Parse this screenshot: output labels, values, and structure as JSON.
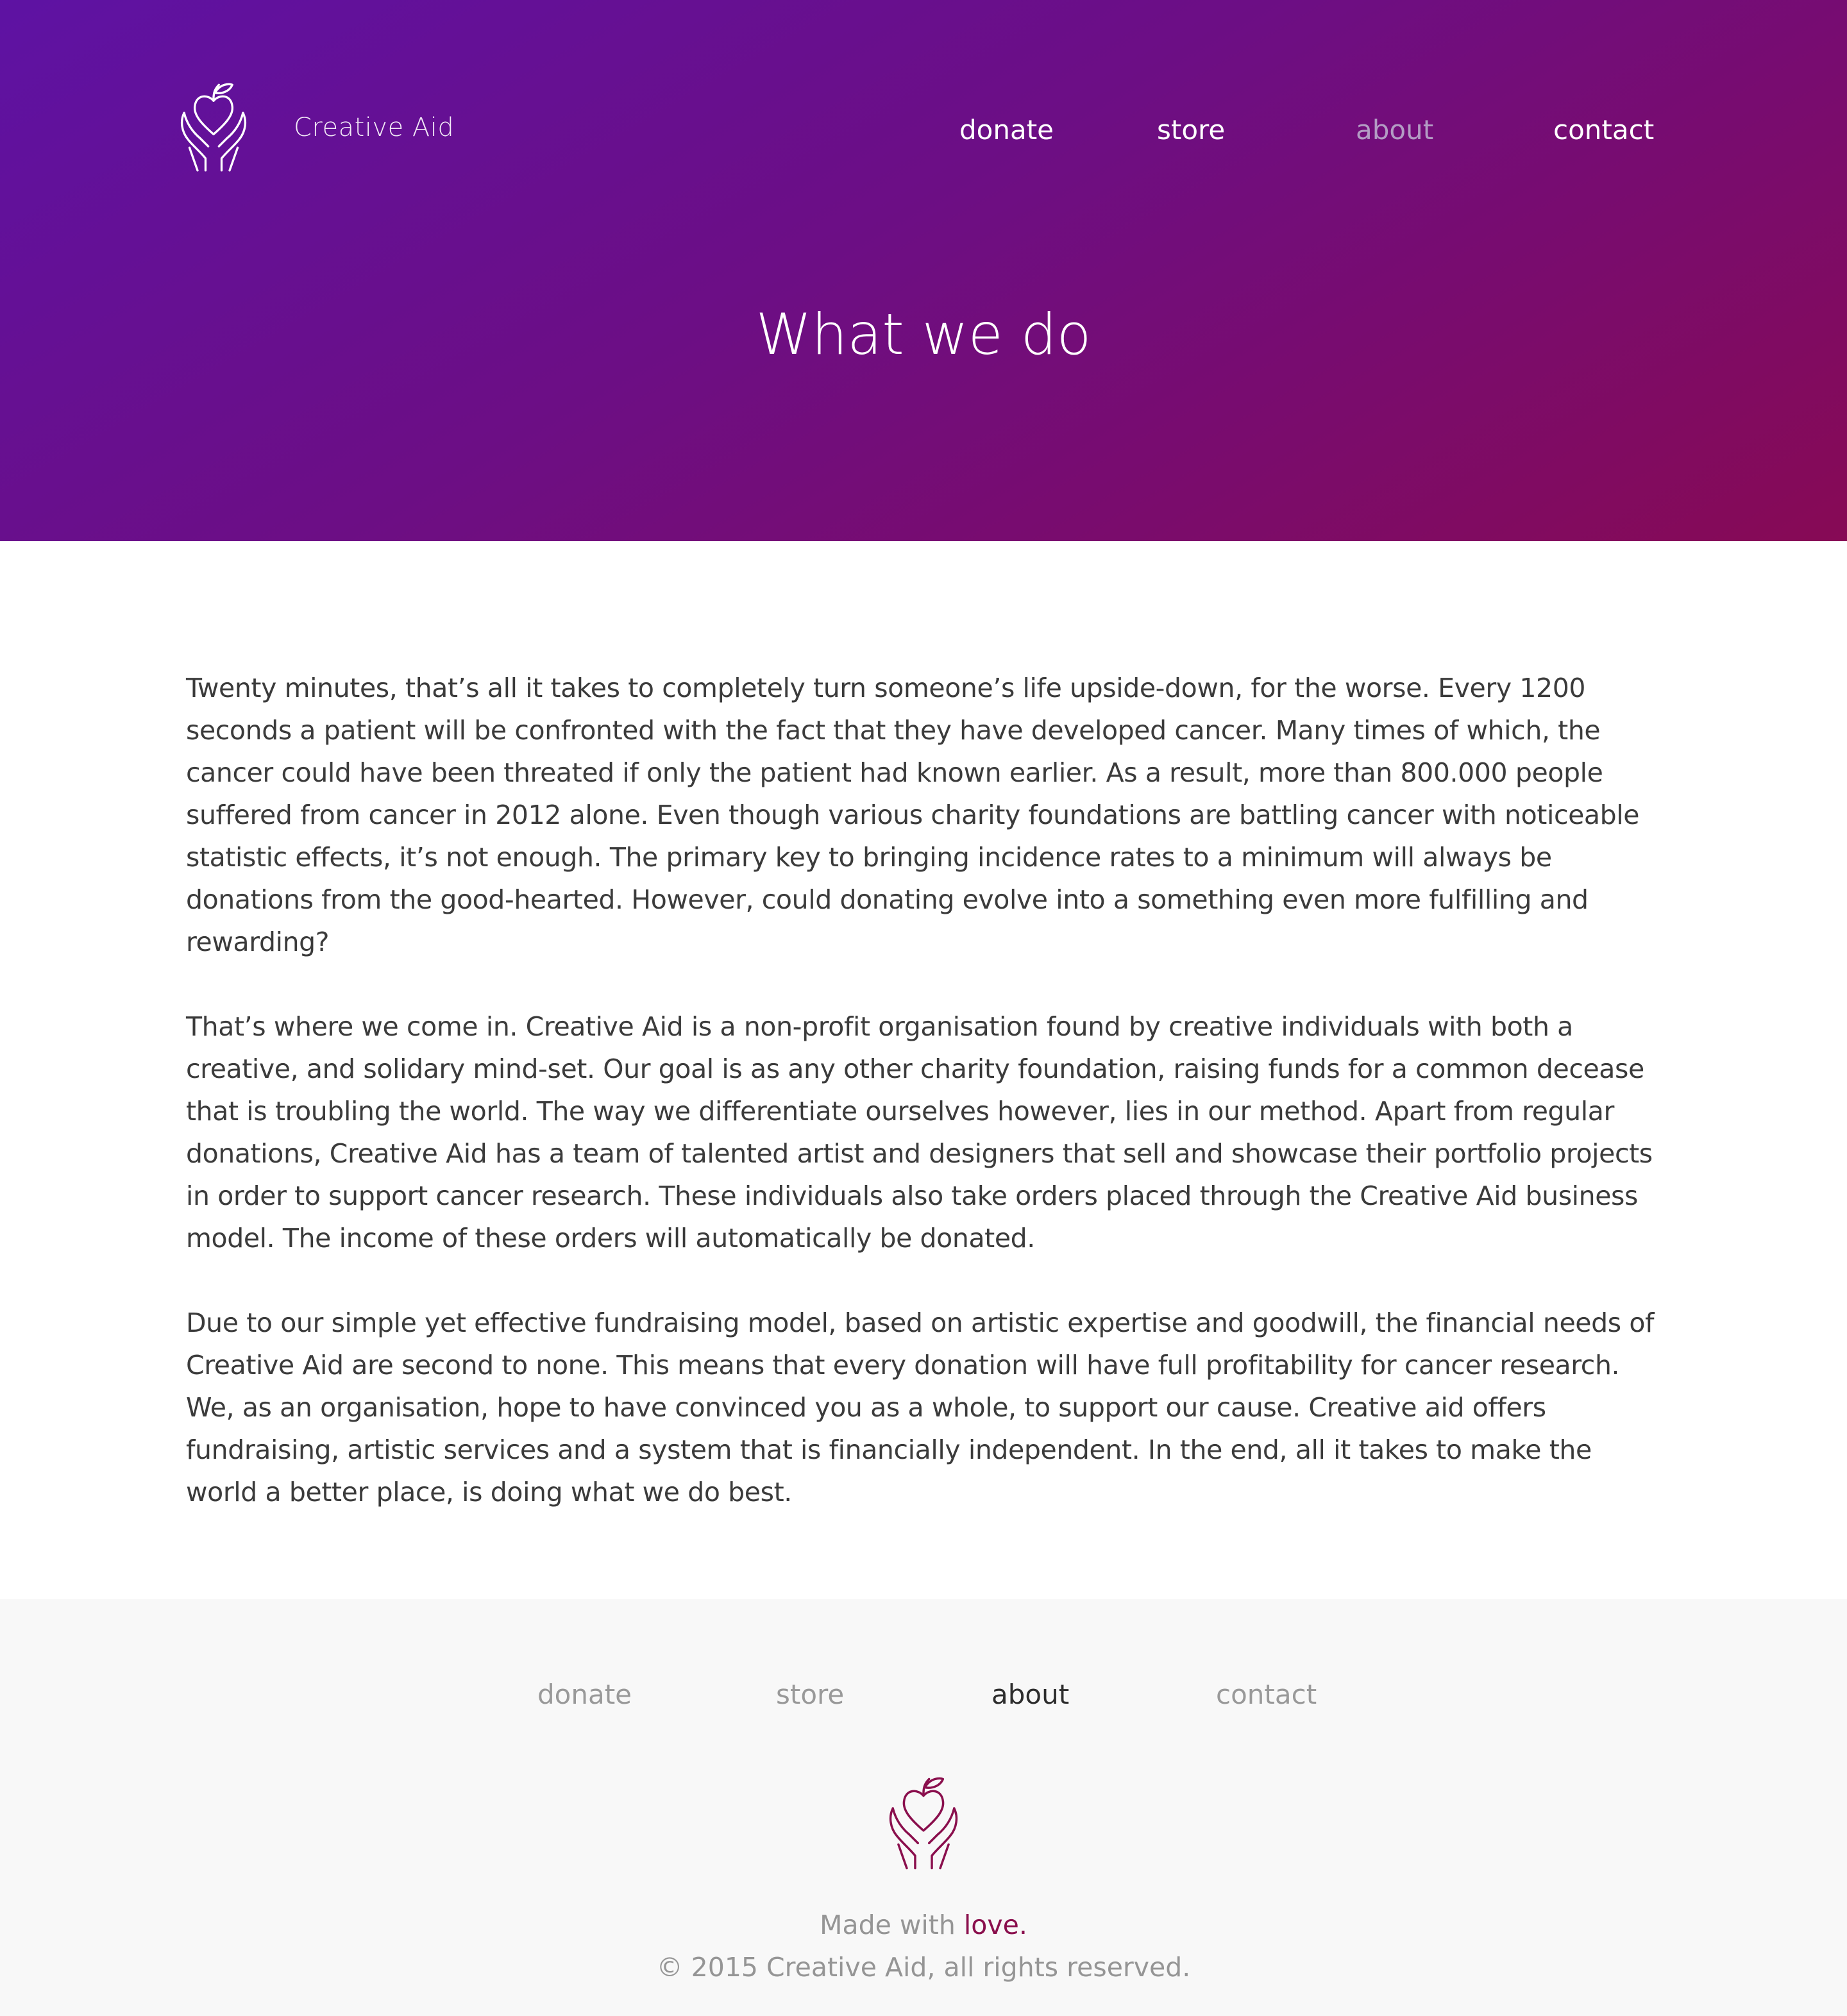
{
  "header": {
    "brand": "Creative Aid",
    "logo_icon": "heart-apple-hands-icon",
    "nav": [
      {
        "label": "donate",
        "active": false
      },
      {
        "label": "store",
        "active": false
      },
      {
        "label": "about",
        "active": true
      },
      {
        "label": "contact",
        "active": false
      }
    ]
  },
  "hero": {
    "title": "What we do",
    "gradient_start": "#5e12a3",
    "gradient_end": "#870a55"
  },
  "main": {
    "paragraphs": [
      "Twenty minutes, that’s all it takes to completely turn someone’s life upside-down, for the worse. Every 1200 seconds a patient will be confronted with the fact that they have developed cancer. Many times of which, the cancer could have been threated if only the patient had known earlier. As a result, more than 800.000 people suffered from cancer in 2012 alone. Even though various charity foundations are battling cancer with noticeable statistic effects, it’s not enough. The primary key to bringing incidence rates to a minimum will always be donations from the good-hearted. However, could donating evolve into a something even more fulfilling and rewarding?",
      "That’s where we come in. Creative Aid is a non-profit organisation found by creative individuals with both a creative, and solidary mind-set. Our goal is as any other charity foundation, raising funds for a common decease that is troubling the world. The way we differentiate ourselves however, lies in our method. Apart from regular donations, Creative Aid has a team of talented artist and designers that sell and showcase their portfolio projects in order to support cancer research. These individuals also take orders placed through the Creative Aid business model. The income of these orders will automatically be donated.",
      "Due to our simple yet effective fundraising model, based on artistic expertise and goodwill, the financial needs of Creative Aid are second to none. This means that every donation will have full profitability for cancer research. We, as an organisation, hope to have convinced you as a whole, to support our cause. Creative aid offers fundraising, artistic services and a system that is financially independent. In the end, all it takes to make the world a better place, is doing what we do best."
    ]
  },
  "footer": {
    "nav": [
      {
        "label": "donate",
        "active": false
      },
      {
        "label": "store",
        "active": false
      },
      {
        "label": "about",
        "active": true
      },
      {
        "label": "contact",
        "active": false
      }
    ],
    "logo_icon": "heart-apple-hands-icon",
    "made_with": "Made with",
    "love": "love.",
    "copyright": "© 2015 Creative Aid, all rights reserved.",
    "accent_color": "#8a0f4d"
  }
}
